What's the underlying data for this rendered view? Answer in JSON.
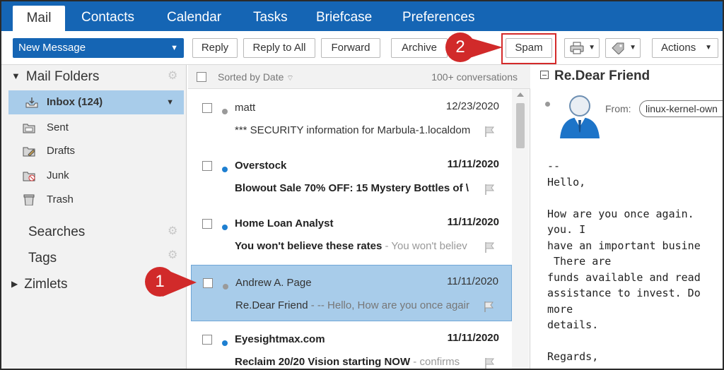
{
  "app_tabs": [
    "Mail",
    "Contacts",
    "Calendar",
    "Tasks",
    "Briefcase",
    "Preferences"
  ],
  "toolbar": {
    "new_message": "New Message",
    "reply": "Reply",
    "reply_all": "Reply to All",
    "forward": "Forward",
    "archive": "Archive",
    "spam": "Spam",
    "actions": "Actions"
  },
  "sidebar": {
    "mail_folders": "Mail Folders",
    "folders": [
      {
        "label": "Inbox (124)",
        "icon": "inbox-icon"
      },
      {
        "label": "Sent",
        "icon": "sent-folder-icon"
      },
      {
        "label": "Drafts",
        "icon": "drafts-folder-icon"
      },
      {
        "label": "Junk",
        "icon": "junk-folder-icon"
      },
      {
        "label": "Trash",
        "icon": "trash-icon"
      }
    ],
    "searches": "Searches",
    "tags": "Tags",
    "zimlets": "Zimlets"
  },
  "list": {
    "sorted_by": "Sorted by Date",
    "count": "100+ conversations",
    "messages": [
      {
        "sender": "matt",
        "date": "12/23/2020",
        "subject": "*** SECURITY information for Marbula-1.localdom",
        "fragment": "",
        "unread": false
      },
      {
        "sender": "Overstock",
        "date": "11/11/2020",
        "subject": "Blowout Sale 70% OFF: 15 Mystery Bottles of \\",
        "fragment": "",
        "unread": true
      },
      {
        "sender": "Home Loan Analyst",
        "date": "11/11/2020",
        "subject": "You won't believe these rates",
        "fragment": " - You won't believ",
        "unread": true
      },
      {
        "sender": "Andrew A. Page",
        "date": "11/11/2020",
        "subject": "Re.Dear Friend",
        "fragment": " - -- Hello, How are you once agair",
        "unread": false
      },
      {
        "sender": "Eyesightmax.com",
        "date": "11/11/2020",
        "subject": "Reclaim 20/20 Vision starting NOW",
        "fragment": " - confirms",
        "unread": true
      }
    ]
  },
  "reader": {
    "title": "Re.Dear Friend",
    "from_label": "From:",
    "from_value": "linux-kernel-own",
    "body": "--\nHello,\n\nHow are you once again.\nyou. I\nhave an important busine\n There are\nfunds available and read\nassistance to invest. Do\nmore\ndetails.\n\nRegards,"
  },
  "callouts": [
    "1",
    "2"
  ],
  "colors": {
    "brand_blue": "#1565b4",
    "selection": "#a8ccea",
    "callout_red": "#d12a2a",
    "unread_dot": "#1e7fd1"
  }
}
